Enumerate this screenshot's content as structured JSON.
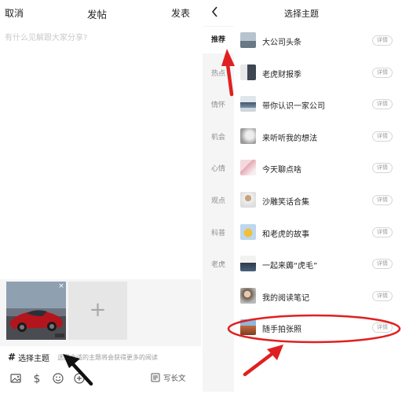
{
  "left": {
    "cancel": "取消",
    "title": "发帖",
    "publish": "发表",
    "placeholder": "有什么见解跟大家分享?",
    "add_tile": "+",
    "close_mark": "×",
    "topic_hash": "#",
    "topic_label": "选择主题",
    "topic_hint": "选择合适的主题将会获得更多的阅读",
    "long_text": "写长文"
  },
  "right": {
    "title": "选择主题",
    "categories": [
      "推荐",
      "热点",
      "情怀",
      "机会",
      "心情",
      "观点",
      "科普",
      "老虎"
    ],
    "active_category": "推荐",
    "topics": [
      {
        "name": "大公司头条",
        "detail": "详情"
      },
      {
        "name": "老虎财报季",
        "detail": "详情"
      },
      {
        "name": "带你认识一家公司",
        "detail": "详情"
      },
      {
        "name": "来听听我的想法",
        "detail": "详情"
      },
      {
        "name": "今天聊点啥",
        "detail": "详情"
      },
      {
        "name": "沙雕笑话合集",
        "detail": "详情"
      },
      {
        "name": "和老虎的故事",
        "detail": "详情"
      },
      {
        "name": "一起来薅“虎毛”",
        "detail": "详情"
      },
      {
        "name": "我的阅读笔记",
        "detail": "详情"
      },
      {
        "name": "随手拍张照",
        "detail": "详情"
      }
    ]
  },
  "colors": {
    "annotation_red": "#e02020",
    "annotation_black": "#111111",
    "category_bg": "#f5f5f5"
  }
}
